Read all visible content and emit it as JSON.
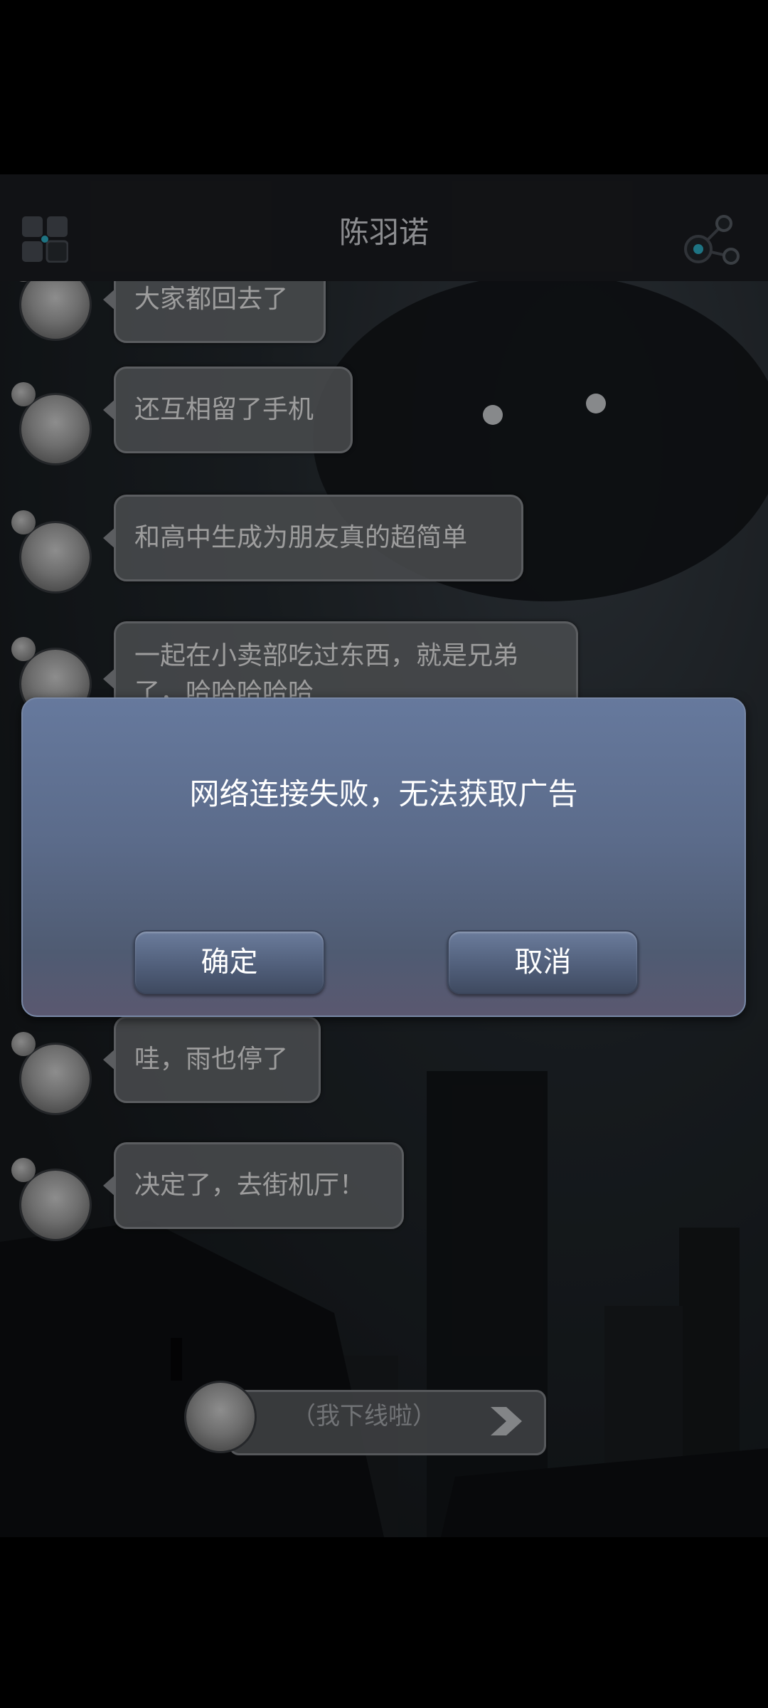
{
  "header": {
    "title": "陈羽诺",
    "menu_icon": "grid-menu-icon",
    "share_icon": "share-icon"
  },
  "messages": [
    {
      "text": "大家都回去了"
    },
    {
      "text": "还互相留了手机"
    },
    {
      "text": "和高中生成为朋友真的超简单"
    },
    {
      "text": "一起在小卖部吃过东西，就是兄弟了，哈哈哈哈哈"
    },
    {
      "text": "哇，雨也停了"
    },
    {
      "text": "决定了，去街机厅！"
    }
  ],
  "offline_button": {
    "label": "（我下线啦）",
    "icon": "send-arrow-icon"
  },
  "dialog": {
    "message": "网络连接失败，无法获取广告",
    "confirm_label": "确定",
    "cancel_label": "取消"
  }
}
